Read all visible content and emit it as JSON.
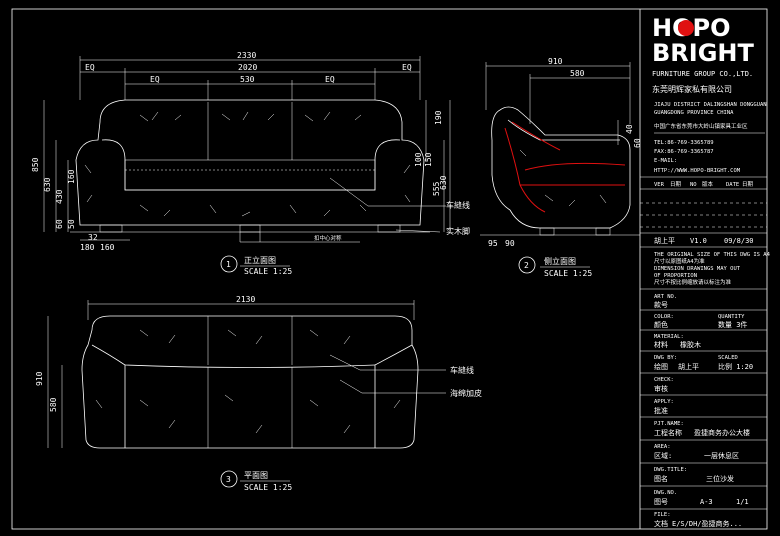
{
  "logo": {
    "brand_line1": "HOPO",
    "brand_line2": "BRIGHT",
    "tagline": "FURNITURE GROUP CO.,LTD.",
    "company_cn": "东莞明辉家私有限公司",
    "accent_color": "#e01010"
  },
  "company": {
    "address_line1": "JIAJU DISTRICT DALINGSHAN DONGGUAN",
    "address_line2": "GUANGDONG PROVINCE CHINA",
    "address_cn": "中国广东省东莞市大岭山镇家具工业区",
    "tel": "TEL:86-769-3365789",
    "fax": "FAX:86-769-3365787",
    "email": "E-MAIL:",
    "http": "HTTP://WWW.HOPO-BRIGHT.COM"
  },
  "revision_header": {
    "ver": "VER",
    "date_cn": "日期",
    "no_en": "NO",
    "ver_cn": "版本",
    "date_en": "DATE",
    "date_cn2": "日期"
  },
  "revision_row": {
    "author": "胡上平",
    "version": "V1.0",
    "date": "09/8/30"
  },
  "notes": [
    "THE ORIGINAL SIZE OF THIS DWG IS A4",
    "尺寸以原图纸A4为准",
    "DIMENSION DRAWINGS MAY OUT",
    "OF PROPORTION",
    "尺寸不按比例缩放请以标注为准"
  ],
  "title_block": {
    "art_no_label": "ART NO.",
    "art_no_value": "款号",
    "color_label": "COLOR:",
    "color_value": "颜色",
    "quantity_label": "QUANTITY",
    "quantity_value": "数量 3件",
    "material_label": "MATERIAL:",
    "material_value": "材料",
    "material_detail": "橡胶木",
    "dwg_by_label": "DWG BY:",
    "dwg_by_value": "绘图",
    "dwg_by_name": "胡上平",
    "scale_label": "SCALED",
    "scale_value": "比例 1:20",
    "check_label": "CHECK:",
    "check_value": "审核",
    "apply_label": "APPLY:",
    "apply_value": "批准",
    "proj_label": "PJT.NAME:",
    "proj_value": "工程名称",
    "proj_name": "盈捷商务办公大楼",
    "area_label": "AREA:",
    "area_value": "区域:",
    "area_name": "一层休息区",
    "dwg_title_label": "DWG.TITLE:",
    "dwg_title_value": "图名",
    "dwg_title_name": "三位沙发",
    "dwg_no_label": "DWG.NO.",
    "dwg_no_value": "图号",
    "dwg_no": "A-3",
    "sheet": "1/1",
    "file_label": "FILE:",
    "file_value": "文档",
    "file_name": "E/S/DH/盈捷商务..."
  },
  "views": {
    "front": {
      "num": "1",
      "title": "正立面图",
      "scale": "SCALE 1:25"
    },
    "side": {
      "num": "2",
      "title": "侧立面图",
      "scale": "SCALE 1:25"
    },
    "plan": {
      "num": "3",
      "title": "平面图",
      "scale": "SCALE 1:25"
    }
  },
  "callouts": {
    "stitch": "车縫线",
    "wood": "实木脚",
    "stitch2": "车縫线",
    "leather": "海绵加皮",
    "gap": "扣中心对称"
  },
  "front_dims": {
    "overall": "2330",
    "inner": "2020",
    "eq1": "EQ",
    "eq2": "EQ",
    "seat_eq1": "EQ",
    "seat_mid": "530",
    "seat_eq2": "EQ",
    "h850": "850",
    "h630": "630",
    "h430": "430",
    "h160": "160",
    "h60": "60",
    "h50": "50",
    "w32": "32",
    "w180": "180",
    "w160": "160",
    "r150": "150",
    "r100": "100",
    "r190": "190",
    "r555": "555",
    "r630": "630"
  },
  "side_dims": {
    "depth": "910",
    "seat": "580",
    "h40": "40",
    "h60": "60",
    "h95": "95",
    "h90": "90"
  },
  "plan_dims": {
    "width": "2130",
    "depth": "910",
    "seat": "580"
  }
}
